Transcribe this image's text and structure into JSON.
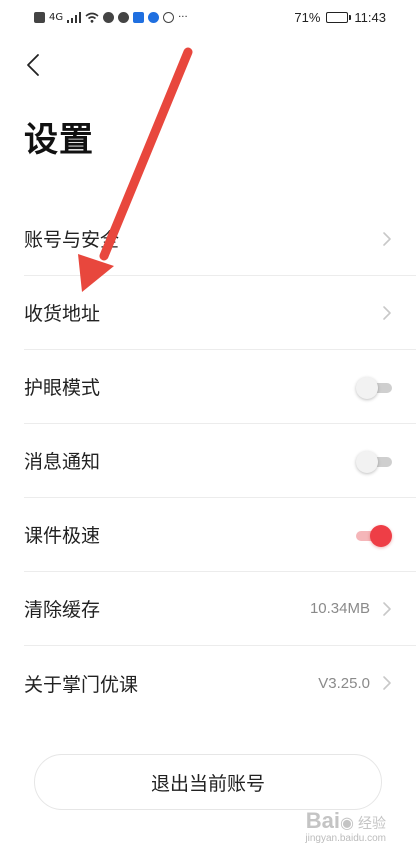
{
  "status_bar": {
    "battery_percent_label": "71%",
    "battery_level": 0.71,
    "time": "11:43",
    "network_label": "4G",
    "more_label": "···"
  },
  "header": {
    "title": "设置"
  },
  "settings": [
    {
      "label": "账号与安全",
      "control": "chevron"
    },
    {
      "label": "收货地址",
      "control": "chevron"
    },
    {
      "label": "护眼模式",
      "control": "toggle",
      "on": false
    },
    {
      "label": "消息通知",
      "control": "toggle",
      "on": false
    },
    {
      "label": "课件极速",
      "control": "toggle",
      "on": true
    },
    {
      "label": "清除缓存",
      "control": "chevron",
      "value": "10.34MB"
    },
    {
      "label": "关于掌门优课",
      "control": "chevron",
      "value": "V3.25.0"
    }
  ],
  "logout_label": "退出当前账号",
  "annotation": {
    "type": "arrow",
    "color": "#e8473d"
  },
  "watermark": {
    "logo": "Bai",
    "suffix": "经验",
    "url": "jingyan.baidu.com"
  },
  "colors": {
    "accent": "#ee3e46",
    "toggle_off": "#cfcfcf",
    "divider": "#ececec"
  },
  "icons": [
    "back-chevron-icon",
    "chevron-right-icon",
    "battery-icon",
    "wifi-icon",
    "signal-icon"
  ]
}
